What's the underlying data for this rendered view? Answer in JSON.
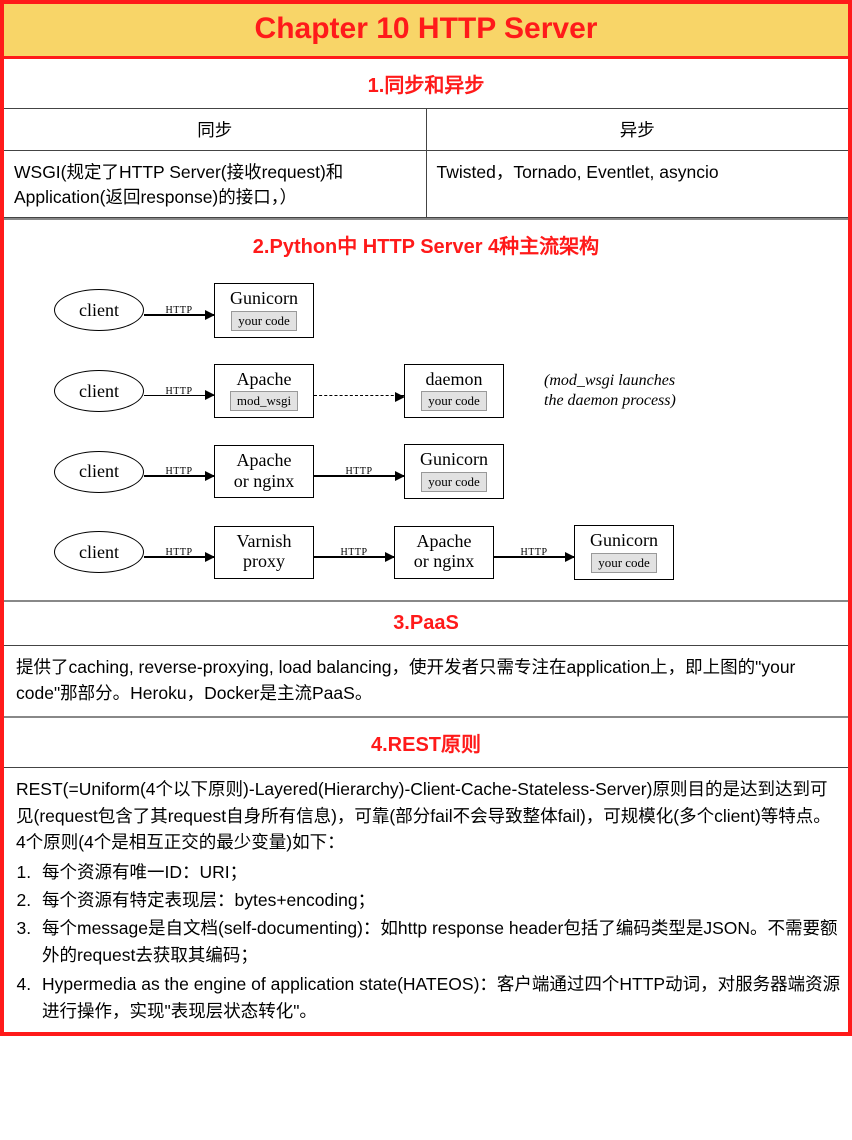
{
  "chapter_title": "Chapter 10 HTTP Server",
  "section1": {
    "header": "1.同步和异步",
    "col1_header": "同步",
    "col2_header": "异步",
    "col1_body": "WSGI(规定了HTTP Server(接收request)和Application(返回response)的接口，）",
    "col2_body": "Twisted，Tornado, Eventlet, asyncio"
  },
  "section2": {
    "header": "2.Python中 HTTP Server 4种主流架构",
    "labels": {
      "client": "client",
      "http": "HTTP",
      "gunicorn": "Gunicorn",
      "your_code": "your code",
      "apache": "Apache",
      "mod_wsgi": "mod_wsgi",
      "daemon": "daemon",
      "apache_or_nginx_1": "Apache",
      "apache_or_nginx_2": "or nginx",
      "varnish_1": "Varnish",
      "varnish_2": "proxy",
      "note_1": "(mod_wsgi launches",
      "note_2": "the daemon process)"
    }
  },
  "section3": {
    "header": "3.PaaS",
    "body": "提供了caching, reverse-proxying, load balancing，使开发者只需专注在application上，即上图的\"your code\"那部分。Heroku，Docker是主流PaaS。"
  },
  "section4": {
    "header": "4.REST原则",
    "intro": "REST(=Uniform(4个以下原则)-Layered(Hierarchy)-Client-Cache-Stateless-Server)原则目的是达到达到可见(request包含了其request自身所有信息)，可靠(部分fail不会导致整体fail)，可规模化(多个client)等特点。4个原则(4个是相互正交的最少变量)如下：",
    "items": [
      "每个资源有唯一ID：URI；",
      "每个资源有特定表现层：bytes+encoding；",
      "每个message是自文档(self-documenting)：如http response header包括了编码类型是JSON。不需要额外的request去获取其编码；",
      "Hypermedia as the engine of application state(HATEOS)：客户端通过四个HTTP动词，对服务器端资源进行操作，实现\"表现层状态转化\"。"
    ]
  }
}
